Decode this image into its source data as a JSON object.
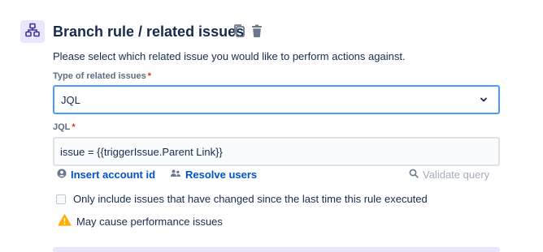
{
  "header": {
    "icon": "branch-hierarchy-icon",
    "title": "Branch rule / related issues",
    "actions": [
      {
        "icon": "copy-icon"
      },
      {
        "icon": "trash-icon"
      }
    ]
  },
  "description": "Please select which related issue you would like to perform actions against.",
  "related_type": {
    "label": "Type of related issues",
    "required_marker": "*",
    "selected_value": "JQL",
    "chevron_icon": "chevron-down-icon"
  },
  "jql": {
    "label": "JQL",
    "required_marker": "*",
    "value": "issue = {{triggerIssue.Parent Link}}"
  },
  "links": {
    "insert_account_id": {
      "label": "Insert account id",
      "icon": "user-circle-icon"
    },
    "resolve_users": {
      "label": "Resolve users",
      "icon": "users-icon"
    },
    "validate_query": {
      "label": "Validate query",
      "icon": "search-icon",
      "disabled": true
    }
  },
  "only_changed": {
    "label": "Only include issues that have changed since the last time this rule executed",
    "checked": false
  },
  "warning": {
    "icon": "warning-icon",
    "text": "May cause performance issues"
  },
  "colors": {
    "accent_blue": "#0052cc",
    "focus_border": "#4c9aff",
    "required_red": "#de350b",
    "icon_purple_bg": "#eae6ff",
    "warning_yellow": "#ffab00"
  }
}
